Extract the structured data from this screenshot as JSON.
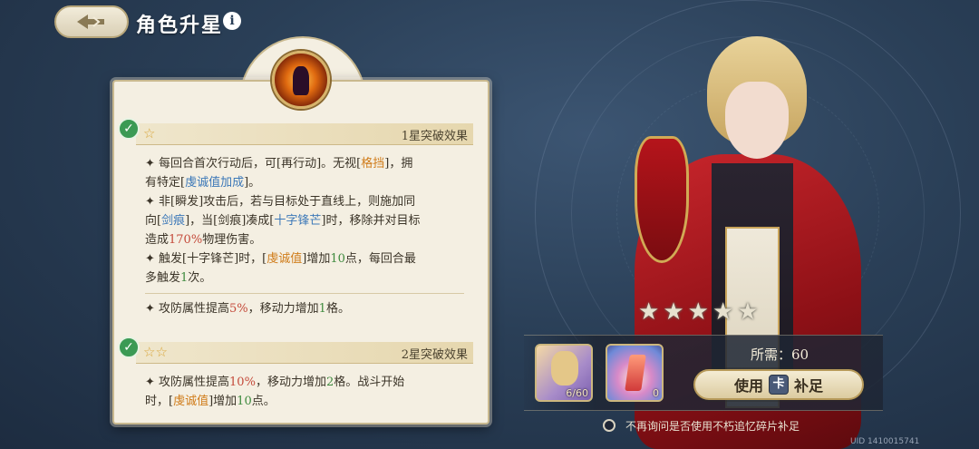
{
  "header": {
    "title": "角色升星",
    "info_symbol": "i"
  },
  "panel": {
    "section1": {
      "stars": "☆",
      "label": "1星突破效果",
      "effects": [
        [
          "✦ 每回合首次行动后，可[再行动]。无视[",
          {
            "t": "格挡",
            "c": "orange"
          },
          "]，拥"
        ],
        [
          "有特定[",
          {
            "t": "虔诚值加成",
            "c": "blue"
          },
          "]。"
        ],
        [
          "✦ 非[瞬发]攻击后，若与目标处于直线上，则施加同"
        ],
        [
          "向[",
          {
            "t": "剑痕",
            "c": "blue"
          },
          "]，当[剑痕]凑成[",
          {
            "t": "十字锋芒",
            "c": "blue"
          },
          "]时，移除并对目标"
        ],
        [
          "造成",
          {
            "t": "170%",
            "c": "red"
          },
          "物理伤害。"
        ],
        [
          "✦ 触发[十字锋芒]时，[",
          {
            "t": "虔诚值",
            "c": "orange"
          },
          "]增加",
          {
            "t": "10",
            "c": "green"
          },
          "点，每回合最"
        ],
        [
          "多触发",
          {
            "t": "1",
            "c": "green"
          },
          "次。"
        ]
      ],
      "stat_line": [
        "✦ 攻防属性提高",
        {
          "t": "5%",
          "c": "red"
        },
        "，移动力增加",
        {
          "t": "1",
          "c": "green"
        },
        "格。"
      ]
    },
    "section2": {
      "stars": "☆☆",
      "label": "2星突破效果",
      "effects": [
        [
          "✦ 攻防属性提高",
          {
            "t": "10%",
            "c": "red"
          },
          "，移动力增加",
          {
            "t": "2",
            "c": "green"
          },
          "格。战斗开始"
        ],
        [
          "时，[",
          {
            "t": "虔诚值",
            "c": "orange"
          },
          "]增加",
          {
            "t": "10",
            "c": "green"
          },
          "点。"
        ]
      ]
    }
  },
  "upgrade_stars": [
    "★",
    "★",
    "★",
    "★",
    "★"
  ],
  "cost": {
    "portrait_count": "6/60",
    "crystal_count": "0",
    "need_label": "所需：60",
    "use_label_prefix": "使用",
    "use_icon": "卡",
    "use_label_suffix": "补足",
    "checkbox_label": "不再询问是否使用不朽追忆碎片补足"
  },
  "uid": "UID 1410015741",
  "colors": {
    "orange": "#d07c1a",
    "blue": "#3c78b8",
    "green": "#3e8a3e",
    "red": "#c44a3a",
    "panel_bg": "#f4efe2",
    "check_green": "#3b9a54"
  }
}
